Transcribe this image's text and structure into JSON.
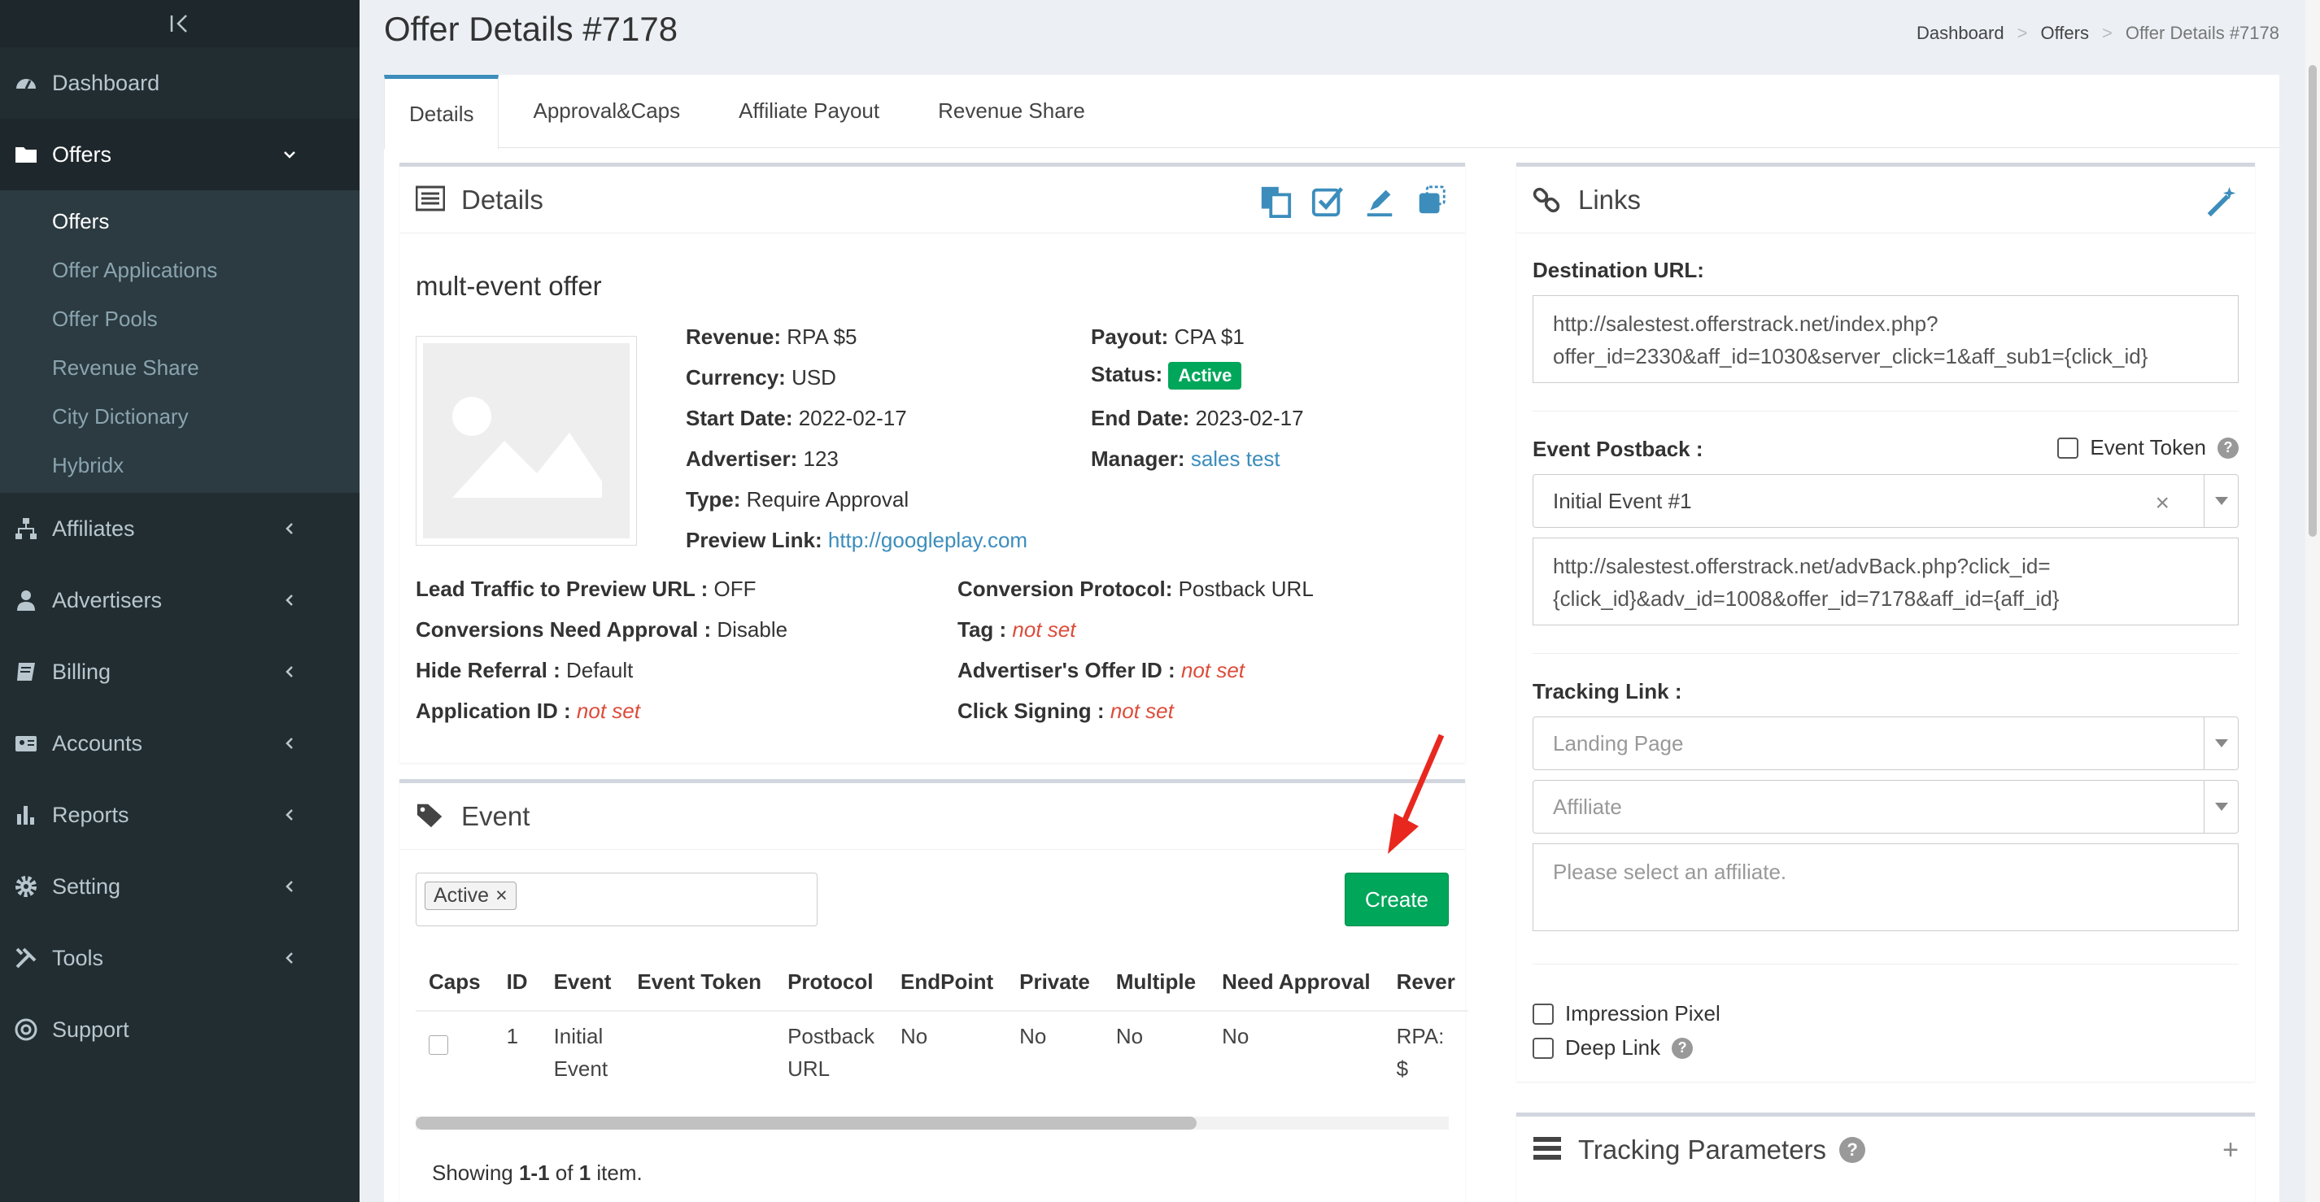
{
  "sidebar": {
    "toggle_icon": "collapse-icon",
    "items": [
      {
        "label": "Dashboard",
        "icon": "dashboard-icon"
      },
      {
        "label": "Offers",
        "icon": "folder-icon"
      },
      {
        "label": "Affiliates",
        "icon": "sitemap-icon"
      },
      {
        "label": "Advertisers",
        "icon": "user-icon"
      },
      {
        "label": "Billing",
        "icon": "book-icon"
      },
      {
        "label": "Accounts",
        "icon": "id-card-icon"
      },
      {
        "label": "Reports",
        "icon": "bar-chart-icon"
      },
      {
        "label": "Setting",
        "icon": "gear-icon"
      },
      {
        "label": "Tools",
        "icon": "tools-icon"
      },
      {
        "label": "Support",
        "icon": "lifebuoy-icon"
      }
    ],
    "offers_submenu": [
      "Offers",
      "Offer Applications",
      "Offer Pools",
      "Revenue Share",
      "City Dictionary",
      "Hybridx"
    ]
  },
  "header": {
    "title": "Offer Details #7178",
    "breadcrumb": [
      "Dashboard",
      "Offers",
      "Offer Details #7178"
    ]
  },
  "tabs": [
    "Details",
    "Approval&Caps",
    "Affiliate Payout",
    "Revenue Share"
  ],
  "details": {
    "title": "Details",
    "offer_name": "mult-event offer",
    "revenue_label": "Revenue:",
    "revenue": "RPA $5",
    "currency_label": "Currency:",
    "currency": "USD",
    "start_label": "Start Date:",
    "start": "2022-02-17",
    "advertiser_label": "Advertiser:",
    "advertiser": "123",
    "type_label": "Type:",
    "type": "Require Approval",
    "preview_label": "Preview Link:",
    "preview": "http://googleplay.com",
    "payout_label": "Payout:",
    "payout": "CPA $1",
    "status_label": "Status:",
    "status": "Active",
    "end_label": "End Date:",
    "end": "2023-02-17",
    "manager_label": "Manager:",
    "manager": "sales test",
    "lead_label": "Lead Traffic to Preview URL :",
    "lead": "OFF",
    "conv_approval_label": "Conversions Need Approval :",
    "conv_approval": "Disable",
    "hide_ref_label": "Hide Referral :",
    "hide_ref": "Default",
    "app_id_label": "Application ID :",
    "app_id": "not set",
    "conv_protocol_label": "Conversion Protocol:",
    "conv_protocol": "Postback URL",
    "tag_label": "Tag :",
    "tag": "not set",
    "adv_offer_label": "Advertiser's Offer ID :",
    "adv_offer": "not set",
    "click_sign_label": "Click Signing :",
    "click_sign": "not set"
  },
  "event": {
    "title": "Event",
    "filter_tag": "Active",
    "filter_tag_remove": "×",
    "create_label": "Create",
    "columns": [
      "Caps",
      "ID",
      "Event",
      "Event Token",
      "Protocol",
      "EndPoint",
      "Private",
      "Multiple",
      "Need Approval",
      "Rever"
    ],
    "row": {
      "id": "1",
      "event_l1": "Initial",
      "event_l2": "Event",
      "token": "",
      "protocol_l1": "Postback",
      "protocol_l2": "URL",
      "endpoint": "No",
      "private": "No",
      "multiple": "No",
      "need_approval": "No",
      "rev": "RPA: $"
    },
    "summary_prefix": "Showing ",
    "summary_range": "1-1",
    "summary_of": " of ",
    "summary_total": "1",
    "summary_suffix": " item."
  },
  "links": {
    "title": "Links",
    "dest_label": "Destination URL:",
    "dest_url_l1": "http://salestest.offerstrack.net/index.php?",
    "dest_url_l2": "offer_id=2330&aff_id=1030&server_click=1&aff_sub1={click_id}",
    "postback_label": "Event Postback :",
    "event_token_label": "Event Token",
    "postback_select": "Initial Event #1",
    "postback_clear": "×",
    "postback_url_l1": "http://salestest.offerstrack.net/advBack.php?click_id=",
    "postback_url_l2": "{click_id}&adv_id=1008&offer_id=7178&aff_id={aff_id}",
    "tracking_label": "Tracking Link :",
    "landing_placeholder": "Landing Page",
    "affiliate_placeholder": "Affiliate",
    "affiliate_msg": "Please select an affiliate.",
    "impression_label": "Impression Pixel",
    "deeplink_label": "Deep Link"
  },
  "tracking_params": {
    "title": "Tracking Parameters",
    "add": "+"
  },
  "colors": {
    "sidebar_bg": "#222d32",
    "accent": "#3c8dbc",
    "success": "#00a65a",
    "danger": "#dd4b39"
  }
}
